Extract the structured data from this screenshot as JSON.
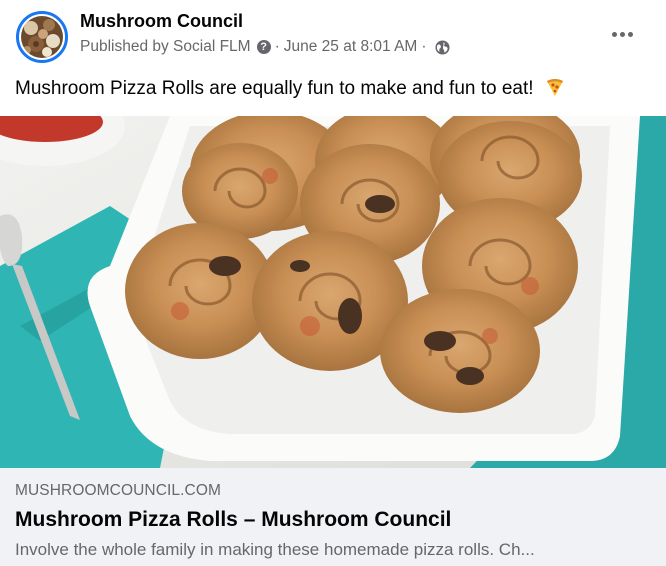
{
  "post": {
    "page_name": "Mushroom Council",
    "published_by": "Published by Social FLM",
    "date": "June 25 at 8:01 AM",
    "separator": "·",
    "info_glyph": "?",
    "caption": "Mushroom Pizza Rolls are equally fun to make and fun to eat!",
    "icons": {
      "avatar": "mushroom-assortment-avatar",
      "info": "question-circle-icon",
      "audience": "globe-icon",
      "more": "more-horizontal-icon",
      "emoji": "pizza-slice-icon"
    }
  },
  "link_preview": {
    "domain": "MUSHROOMCOUNCIL.COM",
    "title": "Mushroom Pizza Rolls – Mushroom Council",
    "description": "Involve the whole family in making these homemade pizza rolls. Ch..."
  },
  "colors": {
    "brand_blue": "#1877f2",
    "secondary_text": "#65676b",
    "link_bg": "#f0f2f5",
    "teal_napkin": "#2cb5b5"
  }
}
